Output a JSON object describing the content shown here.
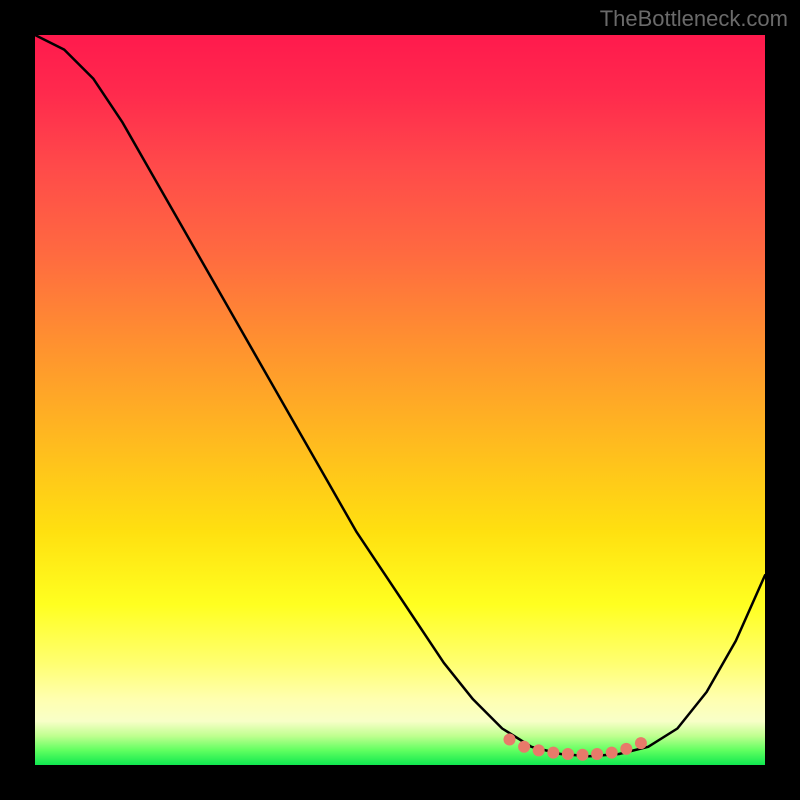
{
  "watermark": "TheBottleneck.com",
  "chart_data": {
    "type": "line",
    "title": "",
    "xlabel": "",
    "ylabel": "",
    "xlim": [
      0,
      100
    ],
    "ylim": [
      0,
      100
    ],
    "series": [
      {
        "name": "curve",
        "color": "#000000",
        "x": [
          0,
          4,
          8,
          12,
          16,
          20,
          24,
          28,
          32,
          36,
          40,
          44,
          48,
          52,
          56,
          60,
          64,
          68,
          72,
          76,
          80,
          84,
          88,
          92,
          96,
          100
        ],
        "values": [
          100,
          98,
          94,
          88,
          81,
          74,
          67,
          60,
          53,
          46,
          39,
          32,
          26,
          20,
          14,
          9,
          5,
          2.5,
          1.5,
          1.2,
          1.5,
          2.5,
          5,
          10,
          17,
          26
        ]
      }
    ],
    "markers": {
      "name": "bottom-dots",
      "color": "#e87a6a",
      "points": [
        {
          "x": 65,
          "y": 3.5
        },
        {
          "x": 67,
          "y": 2.5
        },
        {
          "x": 69,
          "y": 2.0
        },
        {
          "x": 71,
          "y": 1.7
        },
        {
          "x": 73,
          "y": 1.5
        },
        {
          "x": 75,
          "y": 1.4
        },
        {
          "x": 77,
          "y": 1.5
        },
        {
          "x": 79,
          "y": 1.7
        },
        {
          "x": 81,
          "y": 2.2
        },
        {
          "x": 83,
          "y": 3.0
        }
      ]
    },
    "gradient": {
      "top": "#ff1a4d",
      "mid": "#ffe010",
      "bottom": "#10e850"
    }
  }
}
